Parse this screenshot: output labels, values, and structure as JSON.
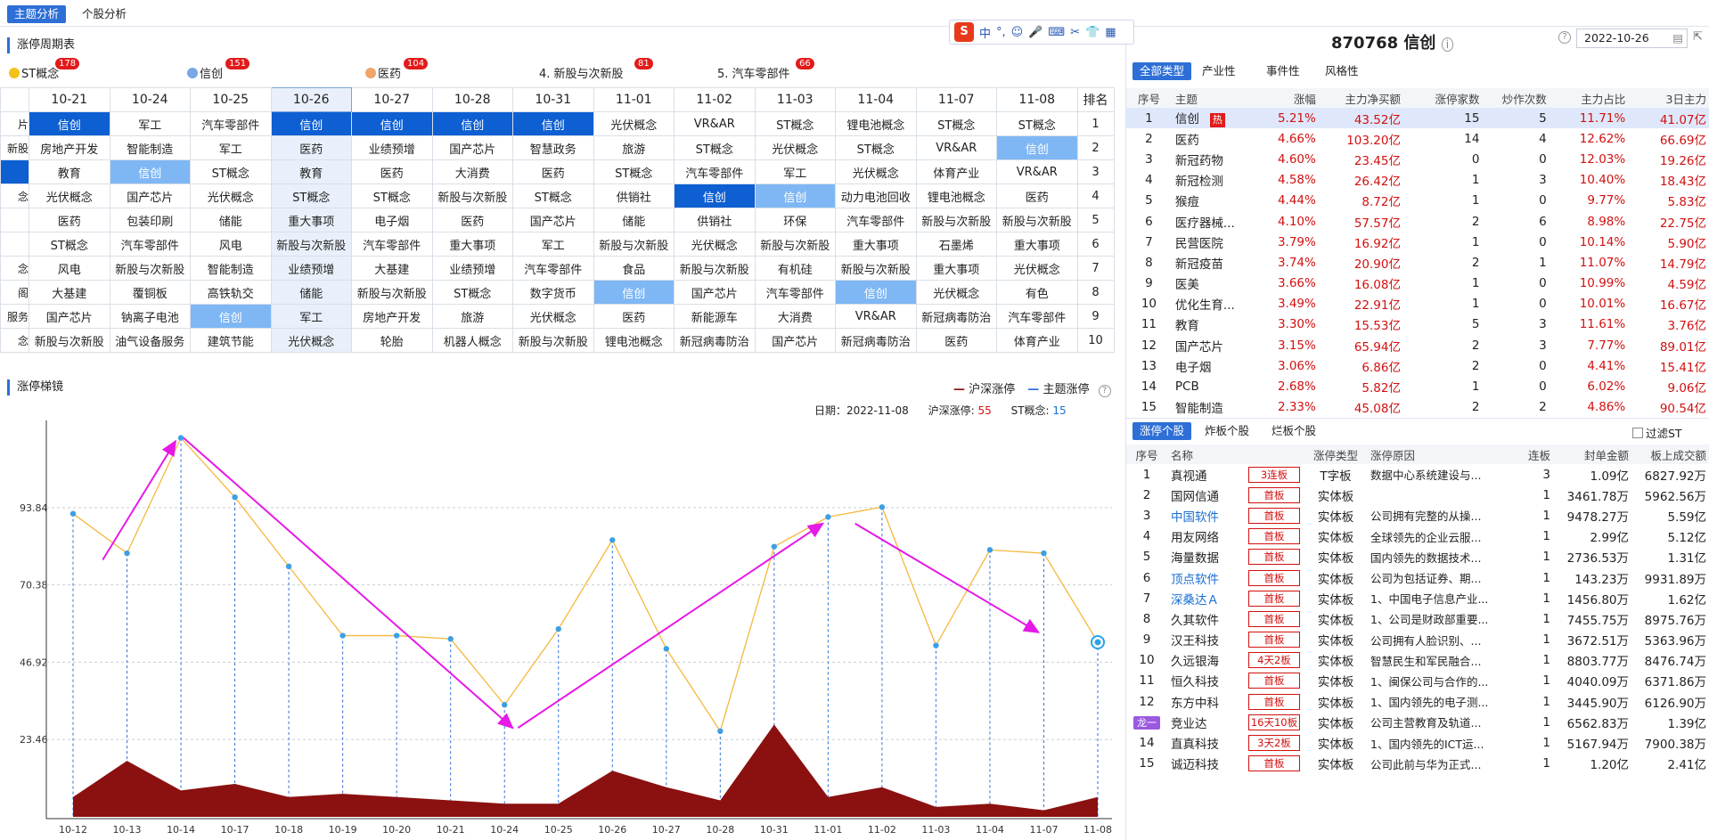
{
  "top_tabs": [
    "主题分析",
    "个股分析"
  ],
  "ime": {
    "logo": "S",
    "mode": "中"
  },
  "limit_cycle": {
    "title": "涨停周期表",
    "themes": [
      {
        "name": "ST概念",
        "count": "178",
        "color": "#f3c11b"
      },
      {
        "name": "信创",
        "count": "151",
        "color": "#78a7e6"
      },
      {
        "name": "医药",
        "count": "104",
        "color": "#f0a56a"
      },
      {
        "name": "4. 新股与次新股",
        "count": "81",
        "color": ""
      },
      {
        "name": "5. 汽车零部件",
        "count": "66",
        "color": ""
      }
    ],
    "dates": [
      "10-21",
      "10-24",
      "10-25",
      "10-26",
      "10-27",
      "10-28",
      "10-31",
      "11-01",
      "11-02",
      "11-03",
      "11-04",
      "11-07",
      "11-08"
    ],
    "rank_label": "排名",
    "left_col": [
      "片",
      "新股",
      "",
      "念",
      "",
      "",
      "念",
      "阁",
      "服务",
      "念"
    ],
    "rows": [
      [
        "信创",
        "军工",
        "汽车零部件",
        "信创",
        "信创",
        "信创",
        "信创",
        "光伏概念",
        "VR&AR",
        "ST概念",
        "锂电池概念",
        "ST概念",
        "ST概念"
      ],
      [
        "房地产开发",
        "智能制造",
        "军工",
        "医药",
        "业绩预增",
        "国产芯片",
        "智慧政务",
        "旅游",
        "ST概念",
        "光伏概念",
        "ST概念",
        "VR&AR",
        "信创"
      ],
      [
        "教育",
        "信创",
        "ST概念",
        "教育",
        "医药",
        "大消费",
        "医药",
        "ST概念",
        "汽车零部件",
        "军工",
        "光伏概念",
        "体育产业",
        "VR&AR"
      ],
      [
        "光伏概念",
        "国产芯片",
        "光伏概念",
        "ST概念",
        "ST概念",
        "新股与次新股",
        "ST概念",
        "供销社",
        "信创",
        "信创",
        "动力电池回收",
        "锂电池概念",
        "医药"
      ],
      [
        "医药",
        "包装印刷",
        "储能",
        "重大事项",
        "电子烟",
        "医药",
        "国产芯片",
        "储能",
        "供销社",
        "环保",
        "汽车零部件",
        "新股与次新股",
        "新股与次新股"
      ],
      [
        "ST概念",
        "汽车零部件",
        "风电",
        "新股与次新股",
        "汽车零部件",
        "重大事项",
        "军工",
        "新股与次新股",
        "光伏概念",
        "新股与次新股",
        "重大事项",
        "石墨烯",
        "重大事项"
      ],
      [
        "风电",
        "新股与次新股",
        "智能制造",
        "业绩预增",
        "大基建",
        "业绩预增",
        "汽车零部件",
        "食品",
        "新股与次新股",
        "有机硅",
        "新股与次新股",
        "重大事项",
        "光伏概念"
      ],
      [
        "大基建",
        "覆铜板",
        "高铁轨交",
        "储能",
        "新股与次新股",
        "ST概念",
        "数字货币",
        "信创",
        "国产芯片",
        "汽车零部件",
        "信创",
        "光伏概念",
        "有色"
      ],
      [
        "国产芯片",
        "钠离子电池",
        "信创",
        "军工",
        "房地产开发",
        "旅游",
        "光伏概念",
        "医药",
        "新能源车",
        "大消费",
        "VR&AR",
        "新冠病毒防治",
        "汽车零部件"
      ],
      [
        "新股与次新股",
        "油气设备服务",
        "建筑节能",
        "光伏概念",
        "轮胎",
        "机器人概念",
        "新股与次新股",
        "锂电池概念",
        "新冠病毒防治",
        "国产芯片",
        "新冠病毒防治",
        "医药",
        "体育产业"
      ]
    ],
    "ranks": [
      "1",
      "2",
      "3",
      "4",
      "5",
      "6",
      "7",
      "8",
      "9",
      "10"
    ]
  },
  "ladder": {
    "title": "涨停梯镜",
    "legend": [
      "沪深涨停",
      "主题涨停"
    ],
    "info": {
      "date_label": "日期：",
      "date": "2022-11-08",
      "hs_label": "沪深涨停:",
      "hs_value": "55",
      "st_label": "ST概念:",
      "st_value": "15"
    }
  },
  "chart_data": {
    "type": "area",
    "x": [
      "10-12",
      "10-13",
      "10-14",
      "10-17",
      "10-18",
      "10-19",
      "10-20",
      "10-21",
      "10-24",
      "10-25",
      "10-26",
      "10-27",
      "10-28",
      "10-31",
      "11-01",
      "11-02",
      "11-03",
      "11-04",
      "11-07",
      "11-08"
    ],
    "yticks": [
      23.46,
      46.92,
      70.38,
      93.84
    ],
    "ylim": [
      0,
      118
    ],
    "series": [
      {
        "name": "主题涨停",
        "color": "#f5b83d",
        "values": [
          92,
          80,
          115,
          97,
          76,
          55,
          55,
          54,
          34,
          57,
          84,
          51,
          26,
          82,
          91,
          94,
          52,
          81,
          80,
          53
        ]
      },
      {
        "name": "沪深涨停",
        "color": "#8b1010",
        "values": [
          6,
          17,
          8,
          10,
          6,
          7,
          6,
          5,
          4,
          4,
          14,
          9,
          5,
          28,
          6,
          9,
          3,
          4,
          2,
          6
        ]
      }
    ]
  },
  "right": {
    "stock_code": "870768 信创",
    "date_value": "2022-10-26",
    "type_tabs": [
      "全部类型",
      "产业性",
      "事件性",
      "风格性"
    ],
    "theme_cols": [
      "序号",
      "主题",
      "涨幅",
      "主力净买额",
      "涨停家数",
      "炒作次数",
      "主力占比",
      "3日主力"
    ],
    "hot_label": "热",
    "themes": [
      [
        "1",
        "信创",
        "5.21%",
        "43.52亿",
        "15",
        "5",
        "11.71%",
        "41.07亿"
      ],
      [
        "2",
        "医药",
        "4.66%",
        "103.20亿",
        "14",
        "4",
        "12.62%",
        "66.69亿"
      ],
      [
        "3",
        "新冠药物",
        "4.60%",
        "23.45亿",
        "0",
        "0",
        "12.03%",
        "19.26亿"
      ],
      [
        "4",
        "新冠检测",
        "4.58%",
        "26.42亿",
        "1",
        "3",
        "10.40%",
        "18.43亿"
      ],
      [
        "5",
        "猴痘",
        "4.44%",
        "8.72亿",
        "1",
        "0",
        "9.77%",
        "5.83亿"
      ],
      [
        "6",
        "医疗器械...",
        "4.10%",
        "57.57亿",
        "2",
        "6",
        "8.98%",
        "22.75亿"
      ],
      [
        "7",
        "民营医院",
        "3.79%",
        "16.92亿",
        "1",
        "0",
        "10.14%",
        "5.90亿"
      ],
      [
        "8",
        "新冠疫苗",
        "3.74%",
        "20.90亿",
        "2",
        "1",
        "11.07%",
        "14.79亿"
      ],
      [
        "9",
        "医美",
        "3.66%",
        "16.08亿",
        "1",
        "0",
        "10.99%",
        "4.59亿"
      ],
      [
        "10",
        "优化生育...",
        "3.49%",
        "22.91亿",
        "1",
        "0",
        "10.01%",
        "16.67亿"
      ],
      [
        "11",
        "教育",
        "3.30%",
        "15.53亿",
        "5",
        "3",
        "11.61%",
        "3.76亿"
      ],
      [
        "12",
        "国产芯片",
        "3.15%",
        "65.94亿",
        "2",
        "3",
        "7.77%",
        "89.01亿"
      ],
      [
        "13",
        "电子烟",
        "3.06%",
        "6.86亿",
        "2",
        "0",
        "4.41%",
        "15.41亿"
      ],
      [
        "14",
        "PCB",
        "2.68%",
        "5.82亿",
        "1",
        "0",
        "6.02%",
        "9.06亿"
      ],
      [
        "15",
        "智能制造",
        "2.33%",
        "45.08亿",
        "2",
        "2",
        "4.86%",
        "90.54亿"
      ]
    ],
    "stock_tabs": [
      "涨停个股",
      "炸板个股",
      "烂板个股"
    ],
    "filter_st": "过滤ST",
    "stock_cols": [
      "序号",
      "名称",
      "涨停类型",
      "涨停原因",
      "连板",
      "封单金额",
      "板上成交额"
    ],
    "dragon_label": "龙一",
    "stocks": [
      [
        "1",
        "真视通",
        "3连板",
        "T字板",
        "数据中心系统建设与...",
        "3",
        "1.09亿",
        "6827.92万"
      ],
      [
        "2",
        "国网信通",
        "首板",
        "实体板",
        "",
        "1",
        "3461.78万",
        "5962.56万"
      ],
      [
        "3",
        "中国软件",
        "首板",
        "实体板",
        "公司拥有完整的从操...",
        "1",
        "9478.27万",
        "5.59亿"
      ],
      [
        "4",
        "用友网络",
        "首板",
        "实体板",
        "全球领先的企业云服...",
        "1",
        "2.99亿",
        "5.12亿"
      ],
      [
        "5",
        "海量数据",
        "首板",
        "实体板",
        "国内领先的数据技术...",
        "1",
        "2736.53万",
        "1.31亿"
      ],
      [
        "6",
        "顶点软件",
        "首板",
        "实体板",
        "公司为包括证券、期...",
        "1",
        "143.23万",
        "9931.89万"
      ],
      [
        "7",
        "深桑达Ａ",
        "首板",
        "实体板",
        "1、中国电子信息产业...",
        "1",
        "1456.80万",
        "1.62亿"
      ],
      [
        "8",
        "久其软件",
        "首板",
        "实体板",
        "1、公司是财政部重要...",
        "1",
        "7455.75万",
        "8975.76万"
      ],
      [
        "9",
        "汉王科技",
        "首板",
        "实体板",
        "公司拥有人脸识别、...",
        "1",
        "3672.51万",
        "5363.96万"
      ],
      [
        "10",
        "久远银海",
        "4天2板",
        "实体板",
        "智慧民生和军民融合...",
        "1",
        "8803.77万",
        "8476.74万"
      ],
      [
        "11",
        "恒久科技",
        "首板",
        "实体板",
        "1、闽保公司与合作的...",
        "1",
        "4040.09万",
        "6371.86万"
      ],
      [
        "12",
        "东方中科",
        "首板",
        "实体板",
        "1、国内领先的电子测...",
        "1",
        "3445.90万",
        "6126.90万"
      ],
      [
        "13",
        "竞业达",
        "16天10板",
        "实体板",
        "公司主营教育及轨道...",
        "1",
        "6562.83万",
        "1.39亿"
      ],
      [
        "14",
        "直真科技",
        "3天2板",
        "实体板",
        "1、国内领先的ICT运...",
        "1",
        "5167.94万",
        "7900.38万"
      ],
      [
        "15",
        "诚迈科技",
        "首板",
        "实体板",
        "公司此前与华为正式...",
        "1",
        "1.20亿",
        "2.41亿"
      ]
    ]
  }
}
